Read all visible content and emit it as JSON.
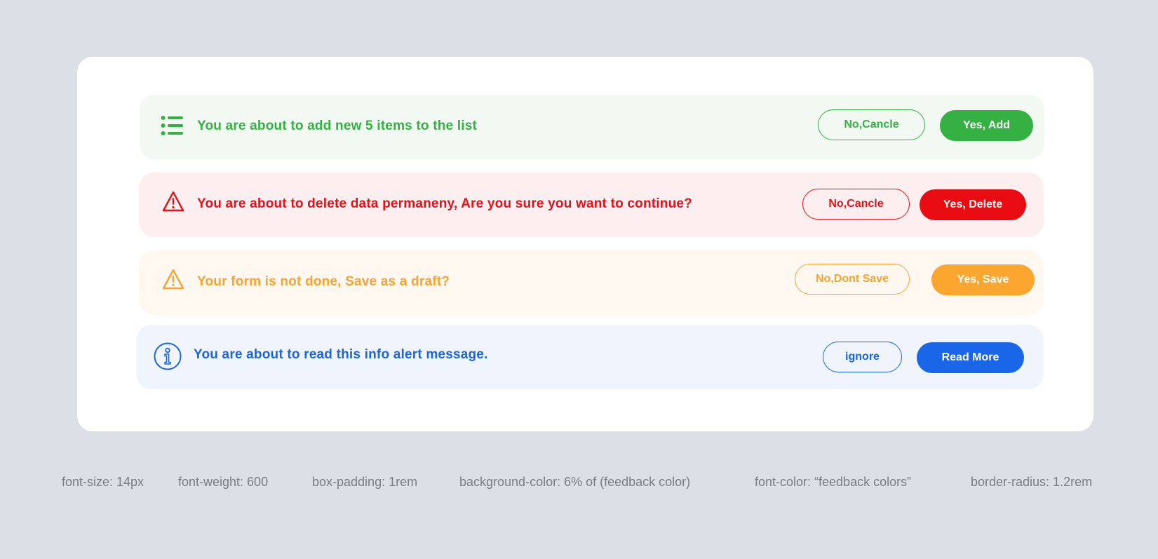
{
  "colors": {
    "page_bg": "#dcdfe6",
    "card_bg": "#ffffff",
    "success": "#35b144",
    "danger": "#e90b12",
    "warning": "#fba62f",
    "info": "#1967e8",
    "spec_text": "#7a7d85"
  },
  "alerts": [
    {
      "type": "success",
      "icon": "list-icon",
      "message": "You are about to add new 5 items to the list",
      "secondary_label": "No,Cancle",
      "primary_label": "Yes, Add"
    },
    {
      "type": "danger",
      "icon": "warning-triangle-icon",
      "message": "You are about to delete data permaneny, Are you sure you want to continue?",
      "secondary_label": "No,Cancle",
      "primary_label": "Yes, Delete"
    },
    {
      "type": "warning",
      "icon": "warning-triangle-icon",
      "message": "Your form is not done, Save as a draft?",
      "secondary_label": "No,Dont Save",
      "primary_label": "Yes, Save"
    },
    {
      "type": "info",
      "icon": "info-circle-icon",
      "message": "You are about to read this info alert message.",
      "secondary_label": "ignore",
      "primary_label": "Read More"
    }
  ],
  "specs": {
    "font_size": "font-size: 14px",
    "font_weight": "font-weight: 600",
    "box_padding": "box-padding: 1rem",
    "background_color": "background-color: 6% of (feedback color)",
    "font_color": "font-color:  “feedback colors”",
    "border_radius": "border-radius: 1.2rem"
  }
}
